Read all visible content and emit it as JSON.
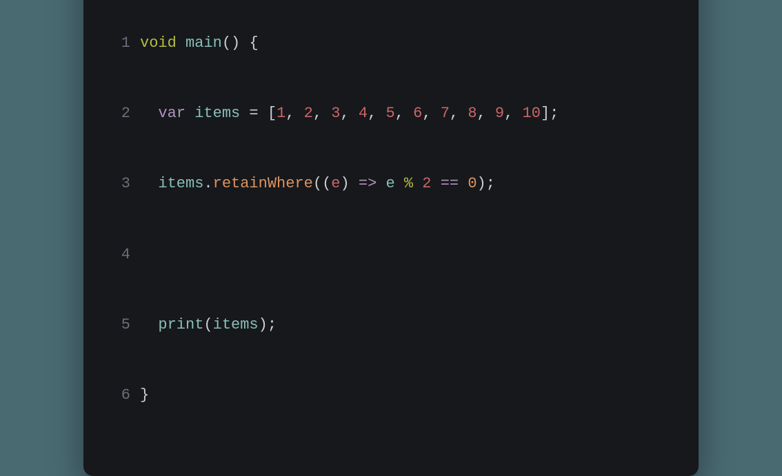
{
  "window": {
    "traffic_lights": [
      "red",
      "yellow",
      "green"
    ]
  },
  "code": {
    "line_numbers": [
      "1",
      "2",
      "3",
      "4",
      "5",
      "6"
    ],
    "line1": {
      "kw_void": "void",
      "fn": "main",
      "open_paren": "(",
      "close_paren": ")",
      "space": " ",
      "open_brace": "{"
    },
    "line2": {
      "indent": "  ",
      "kw_var": "var",
      "ident": "items",
      "eq": " = ",
      "open_bracket": "[",
      "n1": "1",
      "n2": "2",
      "n3": "3",
      "n4": "4",
      "n5": "5",
      "n6": "6",
      "n7": "7",
      "n8": "8",
      "n9": "9",
      "n10": "10",
      "comma": ", ",
      "close_bracket": "]",
      "semi": ";"
    },
    "line3": {
      "indent": "  ",
      "ident": "items",
      "dot": ".",
      "method": "retainWhere",
      "open_paren": "(",
      "open_paren2": "(",
      "param": "e",
      "close_paren2": ")",
      "arrow": " => ",
      "e2": "e",
      "pct": " % ",
      "two": "2",
      "eqeq": " == ",
      "zero": "0",
      "close_paren": ")",
      "semi": ";"
    },
    "line4": {
      "blank": ""
    },
    "line5": {
      "indent": "  ",
      "print": "print",
      "open_paren": "(",
      "ident": "items",
      "close_paren": ")",
      "semi": ";"
    },
    "line6": {
      "close_brace": "}"
    }
  }
}
